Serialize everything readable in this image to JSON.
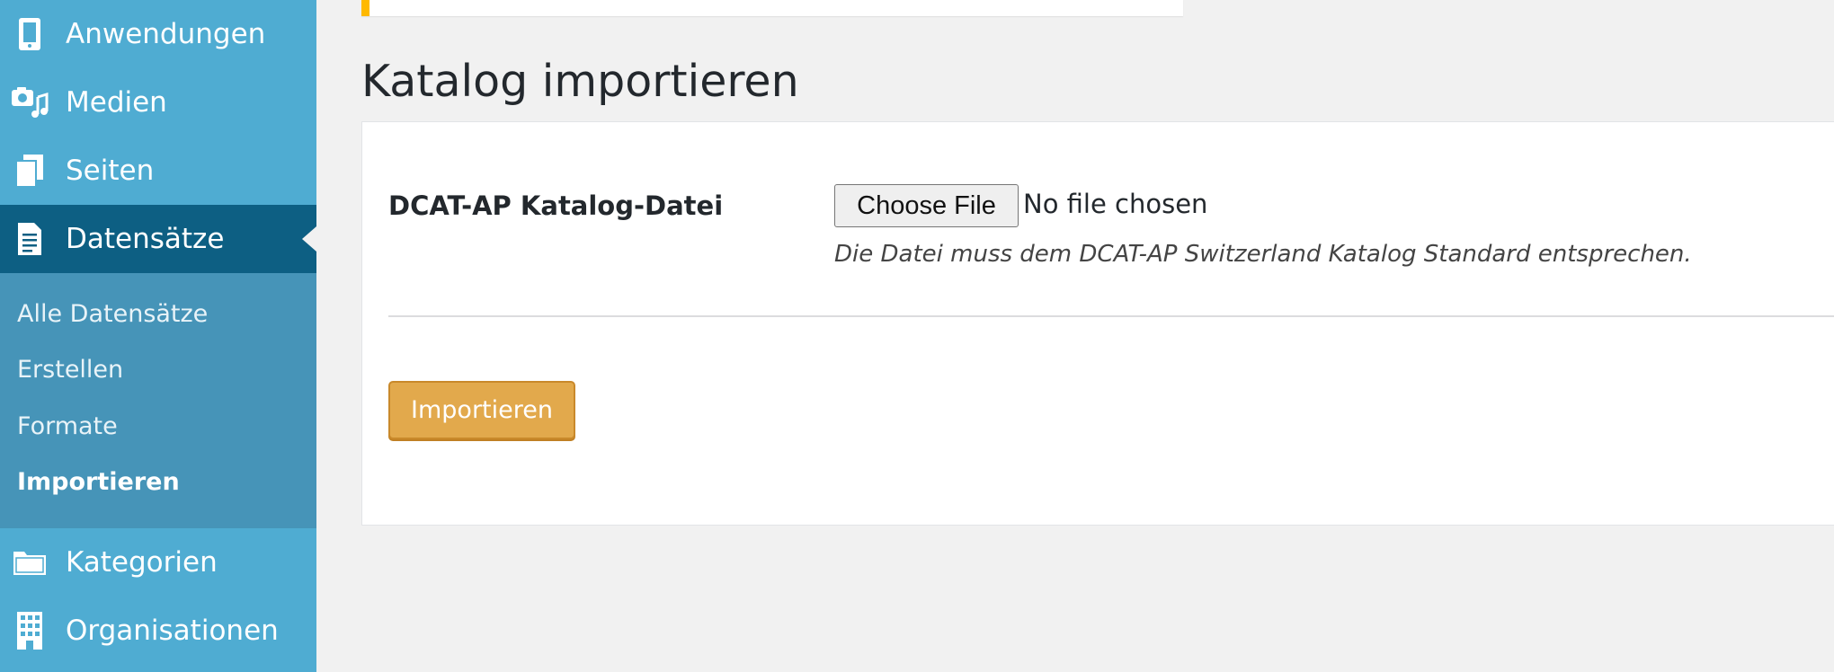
{
  "sidebar": {
    "items": [
      {
        "label": "Anwendungen",
        "icon": "tablet-icon"
      },
      {
        "label": "Medien",
        "icon": "media-icon"
      },
      {
        "label": "Seiten",
        "icon": "pages-icon"
      },
      {
        "label": "Datensätze",
        "icon": "document-icon"
      },
      {
        "label": "Kategorien",
        "icon": "folder-icon"
      },
      {
        "label": "Organisationen",
        "icon": "building-icon"
      }
    ],
    "submenu": [
      {
        "label": "Alle Datensätze"
      },
      {
        "label": "Erstellen"
      },
      {
        "label": "Formate"
      },
      {
        "label": "Importieren"
      }
    ]
  },
  "page": {
    "title": "Katalog importieren"
  },
  "form": {
    "field_label": "DCAT-AP Katalog-Datei",
    "choose_file_label": "Choose File",
    "file_status": "No file chosen",
    "description": "Die Datei muss dem DCAT-AP Switzerland Katalog Standard entsprechen.",
    "submit_label": "Importieren"
  },
  "colors": {
    "sidebar_bg": "#4facd2",
    "sidebar_active": "#0d5f83",
    "submenu_bg": "#4694b8",
    "notice_accent": "#ffb900",
    "submit_bg": "#e2a94c"
  }
}
